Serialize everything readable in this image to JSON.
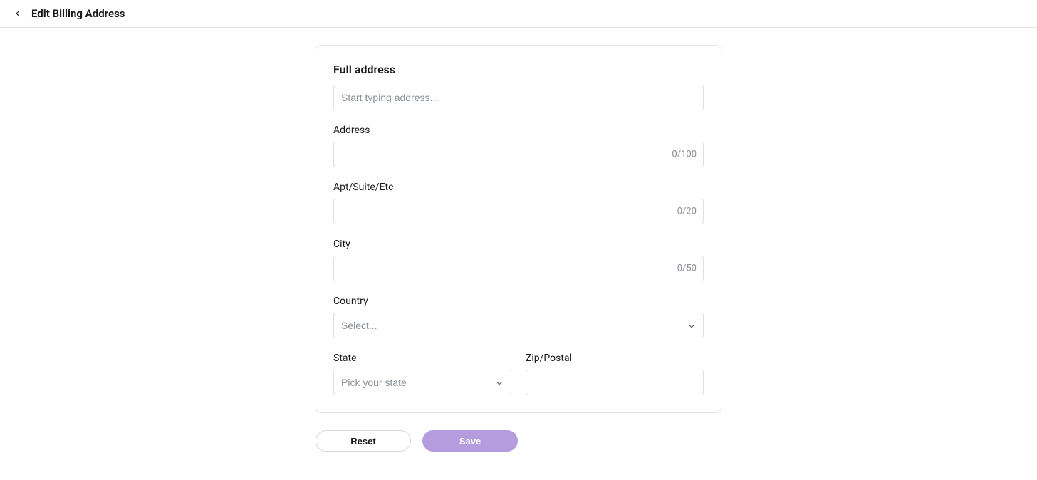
{
  "header": {
    "title": "Edit Billing Address"
  },
  "form": {
    "full_address": {
      "label": "Full address",
      "placeholder": "Start typing address...",
      "value": ""
    },
    "address": {
      "label": "Address",
      "value": "",
      "counter": "0/100"
    },
    "apt": {
      "label": "Apt/Suite/Etc",
      "value": "",
      "counter": "0/20"
    },
    "city": {
      "label": "City",
      "value": "",
      "counter": "0/50"
    },
    "country": {
      "label": "Country",
      "selected": "Select..."
    },
    "state": {
      "label": "State",
      "selected": "Pick your state"
    },
    "zip": {
      "label": "Zip/Postal",
      "value": ""
    }
  },
  "buttons": {
    "reset": "Reset",
    "save": "Save"
  }
}
